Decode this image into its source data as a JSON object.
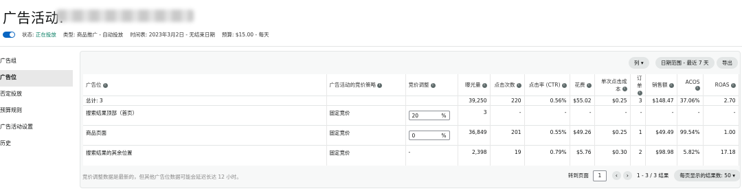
{
  "header": {
    "title": "广告活动:",
    "status_label": "状态:",
    "status_value": "正在投放",
    "type": "类型: 商品推广 - 自动投放",
    "schedule": "时间表: 2023年3月2日 - 无结束日期",
    "budget": "预算: $15.00 - 每天"
  },
  "sidebar": {
    "items": [
      {
        "label": "广告组"
      },
      {
        "label": "广告位"
      },
      {
        "label": "否定投放"
      },
      {
        "label": "预算规则"
      },
      {
        "label": "广告活动设置"
      },
      {
        "label": "历史"
      }
    ]
  },
  "toolbar": {
    "columns_label": "列",
    "date_range_label": "日期范围 - 最近 7 天",
    "export_label": "导出"
  },
  "table": {
    "headers": [
      "广告位",
      "广告活动的竞价策略",
      "竞价调整",
      "曝光量",
      "点击次数",
      "点击率 (CTR)",
      "花费",
      "单次点击成本",
      "订单",
      "销售额",
      "ACOS",
      "ROAS"
    ],
    "total": {
      "label": "总计: 3",
      "impressions": "39,250",
      "clicks": "220",
      "ctr": "0.56%",
      "spend": "$55.02",
      "cpc": "$0.25",
      "orders": "3",
      "sales": "$148.47",
      "acos": "37.06%",
      "roas": "2.70"
    },
    "rows": [
      {
        "placement": "搜索结果顶部（首页）",
        "strategy": "固定竞价",
        "bid": "20",
        "bid_unit": "%",
        "impressions": "3",
        "clicks": "-",
        "ctr": "-",
        "spend": "-",
        "cpc": "-",
        "orders": "-",
        "sales": "-",
        "acos": "-",
        "roas": "-"
      },
      {
        "placement": "商品页面",
        "strategy": "固定竞价",
        "bid": "0",
        "bid_unit": "%",
        "impressions": "36,849",
        "clicks": "201",
        "ctr": "0.55%",
        "spend": "$49.26",
        "cpc": "$0.25",
        "orders": "1",
        "sales": "$49.49",
        "acos": "99.54%",
        "roas": "1.00"
      },
      {
        "placement": "搜索结果的其余位置",
        "strategy": "固定竞价",
        "bid": "-",
        "impressions": "2,398",
        "clicks": "19",
        "ctr": "0.79%",
        "spend": "$5.76",
        "cpc": "$0.30",
        "orders": "2",
        "sales": "$98.98",
        "acos": "5.82%",
        "roas": "17.18"
      }
    ]
  },
  "footer": {
    "note": "竞价调整数据是最新的，但其他广告位数据可能会延迟长达 12 小时。",
    "goto_label": "转到页面",
    "page_value": "1",
    "range_text": "1 - 3 / 3 结果",
    "per_page_label": "每页显示的结果数:",
    "per_page_value": "50"
  },
  "icons": {
    "info": "info-icon",
    "chevron": "chevron-down-icon",
    "prev": "chevron-left-icon",
    "next": "chevron-right-icon"
  },
  "colors": {
    "accent": "#e46b2d",
    "status_green": "#067d62",
    "toggle_blue": "#0a66c2"
  }
}
